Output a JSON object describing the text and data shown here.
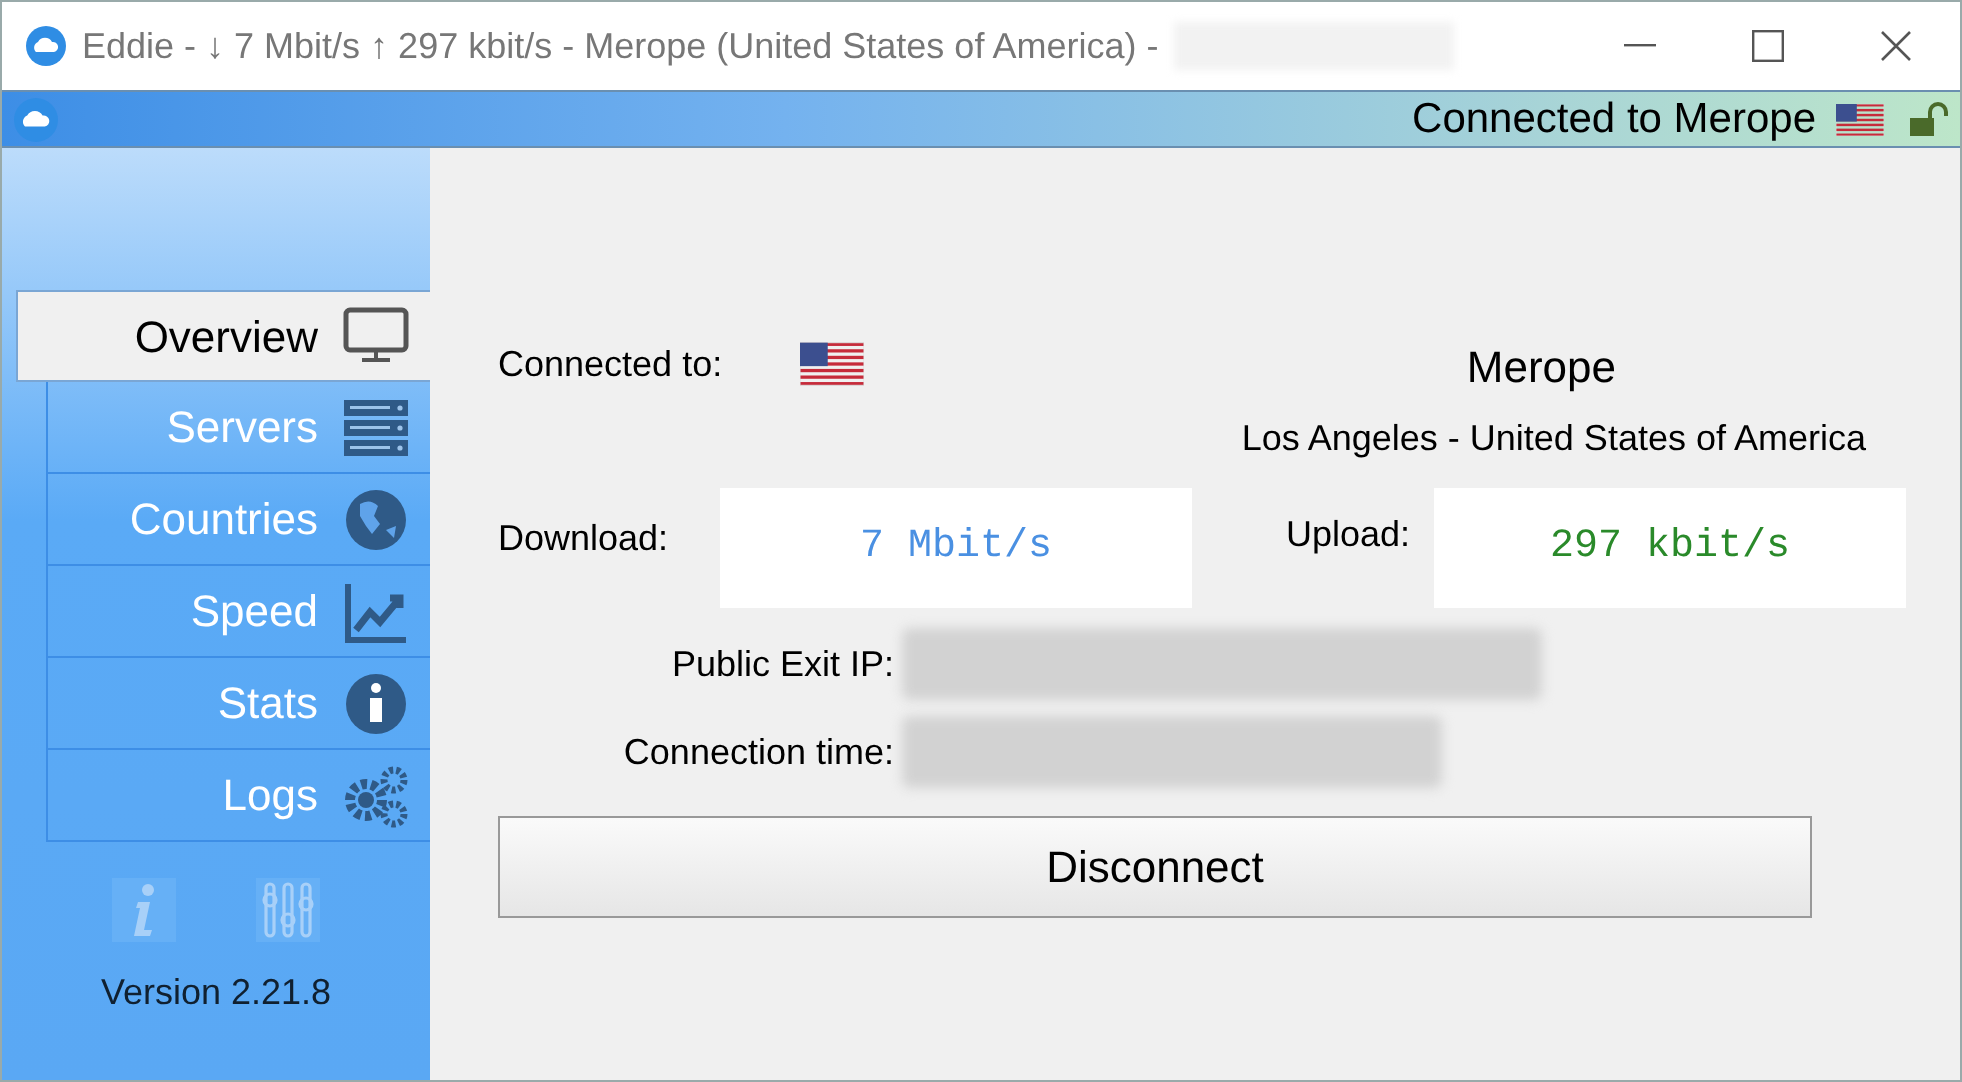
{
  "window": {
    "title": "Eddie - ↓ 7 Mbit/s ↑ 297 kbit/s - Merope (United States of America) -"
  },
  "header": {
    "status": "Connected to Merope",
    "locked": false
  },
  "sidebar": {
    "items": [
      {
        "label": "Overview",
        "kind": "monitor",
        "selected": true
      },
      {
        "label": "Servers",
        "kind": "servers",
        "selected": false
      },
      {
        "label": "Countries",
        "kind": "globe",
        "selected": false
      },
      {
        "label": "Speed",
        "kind": "chart",
        "selected": false
      },
      {
        "label": "Stats",
        "kind": "info",
        "selected": false
      },
      {
        "label": "Logs",
        "kind": "gears",
        "selected": false
      }
    ],
    "version": "Version 2.21.8"
  },
  "overview": {
    "connected_label": "Connected to:",
    "server": "Merope",
    "location": "Los Angeles - United States of America",
    "download_label": "Download:",
    "download": "7 Mbit/s",
    "upload_label": "Upload:",
    "upload": "297 kbit/s",
    "ip_label": "Public Exit IP:",
    "time_label": "Connection time:",
    "button": "Disconnect"
  }
}
